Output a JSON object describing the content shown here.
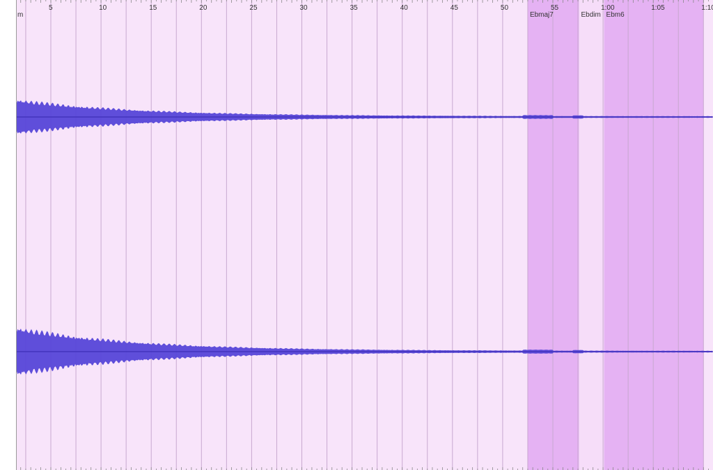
{
  "timeline": {
    "start_label": "m",
    "tick_labels": [
      "5",
      "10",
      "15",
      "20",
      "25",
      "30",
      "35",
      "40",
      "45",
      "50",
      "55",
      "1:00",
      "1:05",
      "1:10"
    ],
    "tick_seconds": [
      5,
      10,
      15,
      20,
      25,
      30,
      35,
      40,
      45,
      50,
      55,
      60,
      65,
      70
    ]
  },
  "chord_regions": [
    {
      "label": "Ebmaj7",
      "start": 52.5,
      "end": 57.6,
      "selected": true
    },
    {
      "label": "Ebdim",
      "start": 57.6,
      "end": 60.1,
      "selected": false
    },
    {
      "label": "Ebm6",
      "start": 60.1,
      "end": 70.0,
      "selected": true
    }
  ],
  "colors": {
    "background": "#f8e4fa",
    "selected_region": "#e5b2f3",
    "unselected_region": "#f6ddf9",
    "gridline": "#c8a8d0",
    "waveform": "#5646d8",
    "waveform_dark": "#3e2fb8"
  }
}
